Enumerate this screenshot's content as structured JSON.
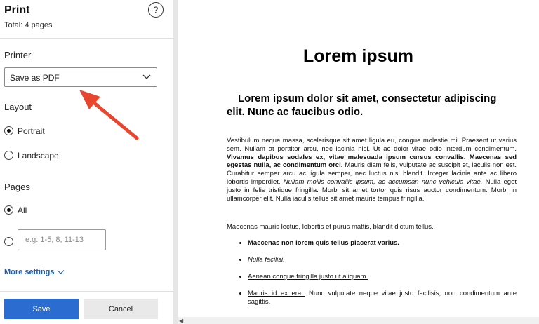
{
  "panel": {
    "title": "Print",
    "total": "Total: 4 pages",
    "help_glyph": "?",
    "printer": {
      "heading": "Printer",
      "selected": "Save as PDF"
    },
    "layout": {
      "heading": "Layout",
      "options": [
        "Portrait",
        "Landscape"
      ],
      "selected": "Portrait"
    },
    "pages": {
      "heading": "Pages",
      "all_label": "All",
      "range_placeholder": "e.g. 1-5, 8, 11-13"
    },
    "more_settings": "More settings",
    "save_label": "Save",
    "cancel_label": "Cancel"
  },
  "colors": {
    "accent": "#2a6ccf",
    "link": "#1d5fb3",
    "annotation_arrow": "#e8462e"
  },
  "preview": {
    "h1": "Lorem ipsum",
    "h2": "Lorem ipsum dolor sit amet, consectetur adipiscing elit. Nunc ac faucibus odio.",
    "p1_a": "Vestibulum neque massa, scelerisque sit amet ligula eu, congue molestie mi. Praesent ut varius sem. Nullam at porttitor arcu, nec lacinia nisi. Ut ac dolor vitae odio interdum condimentum. ",
    "p1_b": "Vivamus dapibus sodales ex, vitae malesuada ipsum cursus convallis. Maecenas sed egestas nulla, ac condimentum orci.",
    "p1_c": " Mauris diam felis, vulputate ac suscipit et, iaculis non est. Curabitur semper arcu ac ligula semper, nec luctus nisl blandit. Integer lacinia ante ac libero lobortis imperdiet. ",
    "p1_d": "Nullam mollis convallis ipsum, ac accumsan nunc vehicula vitae.",
    "p1_e": " Nulla eget justo in felis tristique fringilla. Morbi sit amet tortor quis risus auctor condimentum. Morbi in ullamcorper elit. Nulla iaculis tellus sit amet mauris tempus fringilla.",
    "p2": "Maecenas mauris lectus, lobortis et purus mattis, blandit dictum tellus.",
    "li1": "Maecenas non lorem quis tellus placerat varius.",
    "li2": "Nulla facilisi.",
    "li3": "Aenean congue fringilla justo ut aliquam.",
    "li4_u": "Mauris id ex erat.",
    "li4_rest": " Nunc vulputate neque vitae justo facilisis, non condimentum ante sagittis."
  }
}
